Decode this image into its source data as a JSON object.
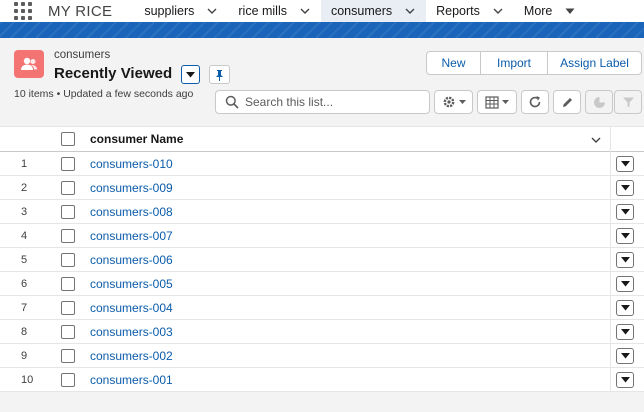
{
  "app": {
    "name": "MY RICE",
    "nav": [
      {
        "label": "suppliers",
        "active": false
      },
      {
        "label": "rice mills",
        "active": false
      },
      {
        "label": "consumers",
        "active": true
      },
      {
        "label": "Reports",
        "active": false
      },
      {
        "label": "More",
        "active": false
      }
    ]
  },
  "header": {
    "object_label": "consumers",
    "list_view": "Recently Viewed",
    "meta": "10 items • Updated a few seconds ago",
    "buttons": {
      "new": "New",
      "import": "Import",
      "assign_label": "Assign Label"
    },
    "search_placeholder": "Search this list..."
  },
  "table": {
    "column_name": "consumer Name",
    "rows": [
      {
        "num": "1",
        "name": "consumers-010"
      },
      {
        "num": "2",
        "name": "consumers-009"
      },
      {
        "num": "3",
        "name": "consumers-008"
      },
      {
        "num": "4",
        "name": "consumers-007"
      },
      {
        "num": "5",
        "name": "consumers-006"
      },
      {
        "num": "6",
        "name": "consumers-005"
      },
      {
        "num": "7",
        "name": "consumers-004"
      },
      {
        "num": "8",
        "name": "consumers-003"
      },
      {
        "num": "9",
        "name": "consumers-002"
      },
      {
        "num": "10",
        "name": "consumers-001"
      }
    ]
  },
  "colors": {
    "brand_blue": "#0b5cab",
    "banner_blue": "#1a65ba",
    "object_icon": "#f47373"
  },
  "icons": {
    "app_launcher": "waffle-icon",
    "object": "contact-group-icon",
    "list_switcher": "chevron-down-icon",
    "pin": "pin-icon",
    "search": "search-icon",
    "settings": "gear-icon",
    "display_as": "table-icon",
    "refresh": "refresh-icon",
    "edit": "pencil-icon",
    "charts": "chart-icon",
    "filter": "filter-icon",
    "row_action": "chevron-down-icon"
  }
}
